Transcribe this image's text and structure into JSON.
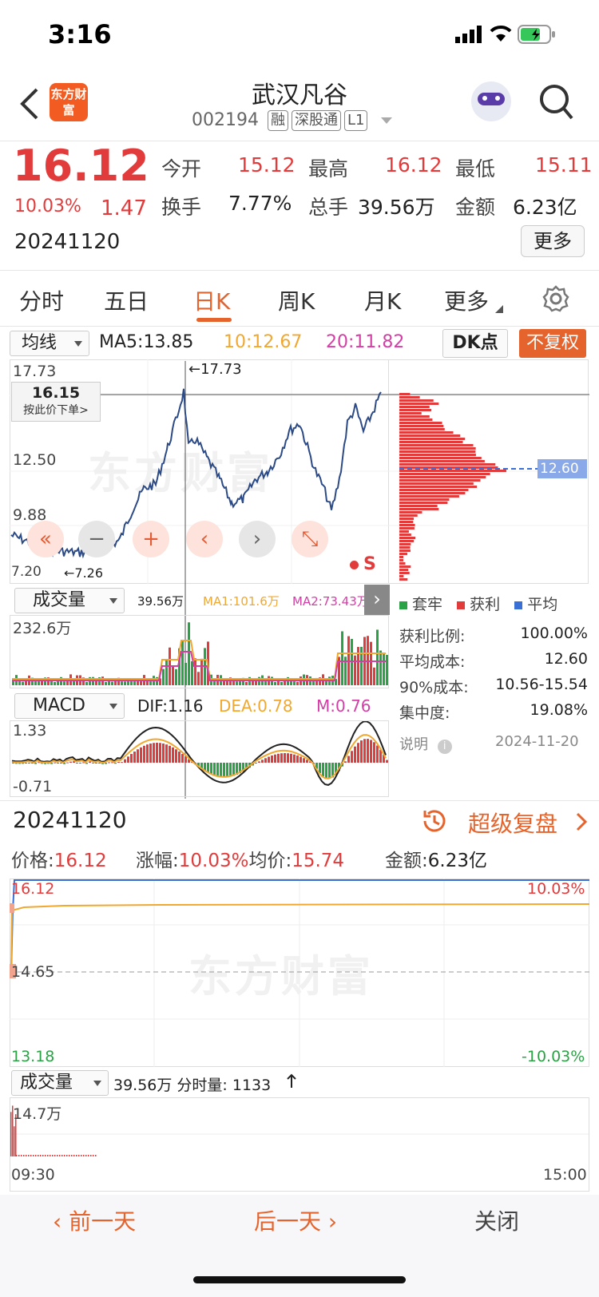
{
  "status_bar": {
    "time": "3:16"
  },
  "header": {
    "stock_name": "武汉凡谷",
    "stock_code": "002194",
    "tags": [
      "融",
      "深股通",
      "L1"
    ],
    "logo_text": "东方财富"
  },
  "quote": {
    "price": "16.12",
    "change_pct": "10.03%",
    "change": "1.47",
    "date": "20241120",
    "open_label": "今开",
    "open": "15.12",
    "high_label": "最高",
    "high": "16.12",
    "low_label": "最低",
    "low": "15.11",
    "turnover_label": "换手",
    "turnover": "7.77%",
    "volume_label": "总手",
    "volume": "39.56万",
    "amount_label": "金额",
    "amount": "6.23亿",
    "more_label": "更多"
  },
  "tabs": [
    "分时",
    "五日",
    "日K",
    "周K",
    "月K",
    "更多"
  ],
  "active_tab": "日K",
  "kline": {
    "ma_select": "均线",
    "ma5": "MA5:13.85",
    "ma10": "10:12.67",
    "ma20": "20:11.82",
    "dk_label": "DK点",
    "fq_label": "不复权",
    "y_top": "17.73",
    "y_mid1": "12.50",
    "y_mid2": "9.88",
    "y_bottom": "7.20",
    "max_marker": "←17.73",
    "min_marker": "←7.26",
    "cursor_price": "16.15",
    "cursor_hint": "按此价下单>",
    "cost_line_label": "12.60"
  },
  "volume_panel": {
    "select": "成交量",
    "vol": "39.56万",
    "ma1": "MA1:101.6万",
    "ma2": "MA2:73.43万",
    "y_top": "232.6万"
  },
  "macd_panel": {
    "select": "MACD",
    "dif": "DIF:1.16",
    "dea": "DEA:0.78",
    "m": "M:0.76",
    "y_top": "1.33",
    "y_bottom": "-0.71"
  },
  "chip_legend": [
    "套牢",
    "获利",
    "平均"
  ],
  "chip_info": [
    {
      "label": "获利比例:",
      "value": "100.00%"
    },
    {
      "label": "平均成本:",
      "value": "12.60"
    },
    {
      "label": "90%成本:",
      "value": "10.56-15.54"
    },
    {
      "label": "集中度:",
      "value": "19.08%"
    }
  ],
  "chip_note": {
    "label": "说明",
    "date": "2024-11-20"
  },
  "replay": {
    "date": "20241120",
    "link": "超级复盘",
    "price_label": "价格:",
    "price": "16.12",
    "pct_label": "涨幅:",
    "pct": "10.03%",
    "avg_label": "均价:",
    "avg": "15.74",
    "amt_label": "金额:",
    "amt": "6.23亿",
    "y_top": "16.12",
    "y_mid": "14.65",
    "y_bottom": "13.18",
    "pct_top": "10.03%",
    "pct_bottom": "-10.03%",
    "vol_select": "成交量",
    "vol_text": "39.56万 分时量: 1133",
    "vol_top": "14.7万",
    "time_start": "09:30",
    "time_end": "15:00"
  },
  "bottom_nav": {
    "prev": "前一天",
    "next": "后一天",
    "close": "关闭"
  },
  "colors": {
    "red": "#e23b3b",
    "green": "#2aa245",
    "line": "#2c4a86",
    "ma10": "#f0a830",
    "ma20": "#d23fa5",
    "accent": "#e5632c"
  }
}
